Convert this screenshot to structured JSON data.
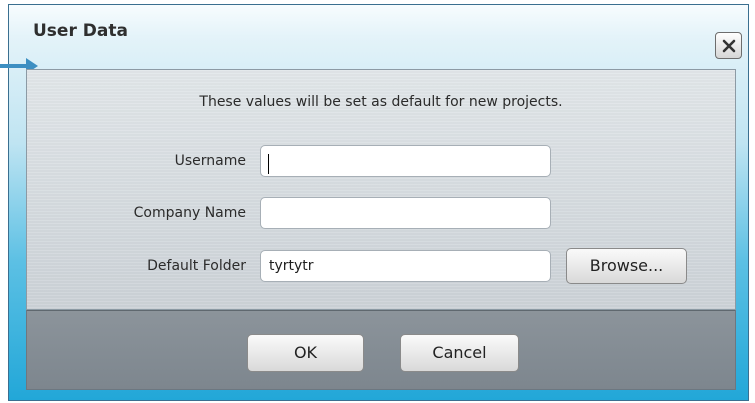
{
  "dialog": {
    "title": "User Data",
    "info_text": "These values will be set as default for new projects."
  },
  "fields": {
    "username": {
      "label": "Username",
      "value": ""
    },
    "company": {
      "label": "Company Name",
      "value": ""
    },
    "folder": {
      "label": "Default Folder",
      "value": "tyrtytr"
    }
  },
  "buttons": {
    "browse": "Browse...",
    "ok": "OK",
    "cancel": "Cancel"
  },
  "icons": {
    "close": "close-icon",
    "arrow": "arrow-right-icon"
  },
  "colors": {
    "accent": "#22a7d8",
    "arrow": "#3d8fc2"
  }
}
